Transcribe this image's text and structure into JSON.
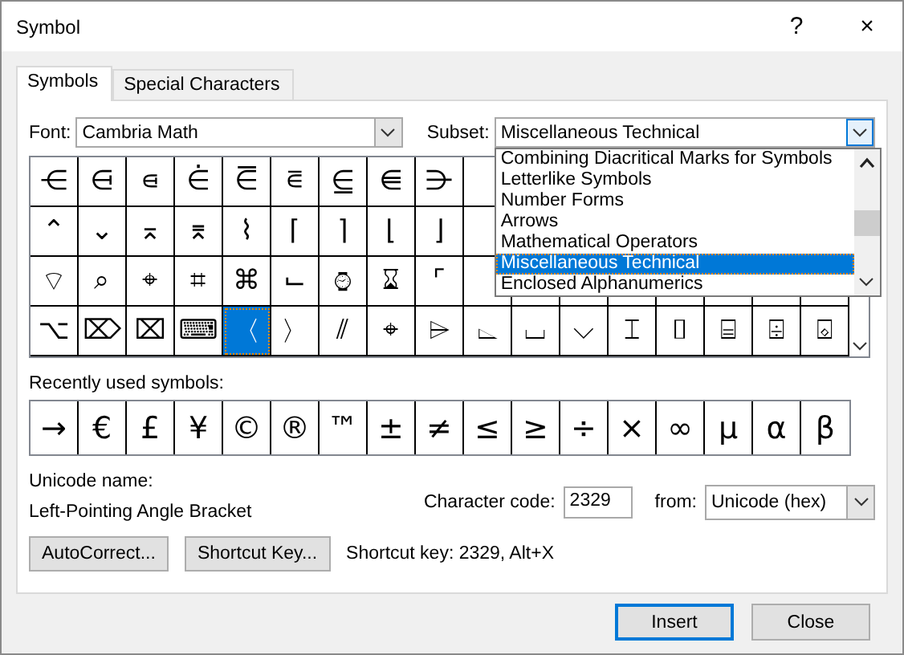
{
  "window": {
    "title": "Symbol",
    "help_button": "?",
    "close_button": "×"
  },
  "tabs": [
    {
      "label": "Symbols",
      "selected": true
    },
    {
      "label": "Special Characters",
      "selected": false
    }
  ],
  "font": {
    "label": "Font:",
    "value": "Cambria Math"
  },
  "subset": {
    "label": "Subset:",
    "value": "Miscellaneous Technical",
    "expanded": true,
    "options": [
      {
        "label": "Combining Diacritical Marks for Symbols",
        "selected": false
      },
      {
        "label": "Letterlike Symbols",
        "selected": false
      },
      {
        "label": "Number Forms",
        "selected": false
      },
      {
        "label": "Arrows",
        "selected": false
      },
      {
        "label": "Mathematical Operators",
        "selected": false
      },
      {
        "label": "Miscellaneous Technical",
        "selected": true
      },
      {
        "label": "Enclosed Alphanumerics",
        "selected": false
      }
    ]
  },
  "symbol_grid": {
    "rows": [
      {
        "cells": [
          {
            "symbol": "⋲",
            "selected": false
          },
          {
            "symbol": "⋳",
            "selected": false
          },
          {
            "symbol": "⋴",
            "selected": false
          },
          {
            "symbol": "⋵",
            "selected": false
          },
          {
            "symbol": "⋶",
            "selected": false
          },
          {
            "symbol": "⋷",
            "selected": false
          },
          {
            "symbol": "⋸",
            "selected": false
          },
          {
            "symbol": "⋹",
            "selected": false
          },
          {
            "symbol": "⋺",
            "selected": false
          }
        ]
      },
      {
        "cells": [
          {
            "symbol": "⌃",
            "selected": false
          },
          {
            "symbol": "⌄",
            "selected": false
          },
          {
            "symbol": "⌅",
            "selected": false
          },
          {
            "symbol": "⌆",
            "selected": false
          },
          {
            "symbol": "⌇",
            "selected": false
          },
          {
            "symbol": "⌈",
            "selected": false
          },
          {
            "symbol": "⌉",
            "selected": false
          },
          {
            "symbol": "⌊",
            "selected": false
          },
          {
            "symbol": "⌋",
            "selected": false
          }
        ]
      },
      {
        "cells": [
          {
            "symbol": "⌔",
            "selected": false
          },
          {
            "symbol": "⌕",
            "selected": false
          },
          {
            "symbol": "⌖",
            "selected": false
          },
          {
            "symbol": "⌗",
            "selected": false
          },
          {
            "symbol": "⌘",
            "selected": false
          },
          {
            "symbol": "⌙",
            "selected": false
          },
          {
            "symbol": "⌚︎",
            "selected": false
          },
          {
            "symbol": "⌛︎",
            "selected": false
          },
          {
            "symbol": "⌜",
            "selected": false
          }
        ]
      },
      {
        "cells": [
          {
            "symbol": "⌥",
            "selected": false
          },
          {
            "symbol": "⌦",
            "selected": false
          },
          {
            "symbol": "⌧",
            "selected": false
          },
          {
            "symbol": "⌨",
            "selected": false
          },
          {
            "symbol": "〈",
            "selected": true
          },
          {
            "symbol": "〉",
            "selected": false
          },
          {
            "symbol": "⫽",
            "selected": false
          },
          {
            "symbol": "⌖",
            "selected": false
          },
          {
            "symbol": "⌲",
            "selected": false
          },
          {
            "symbol": "⌳",
            "selected": false
          },
          {
            "symbol": "⌴",
            "selected": false
          },
          {
            "symbol": "⌵",
            "selected": false
          },
          {
            "symbol": "⌶",
            "selected": false
          },
          {
            "symbol": "⌷",
            "selected": false
          },
          {
            "symbol": "⌸",
            "selected": false
          },
          {
            "symbol": "⌹",
            "selected": false
          },
          {
            "symbol": "⌺",
            "selected": false
          }
        ]
      }
    ]
  },
  "recent": {
    "label": "Recently used symbols:",
    "symbols": [
      "→",
      "€",
      "£",
      "¥",
      "©",
      "®",
      "™",
      "±",
      "≠",
      "≤",
      "≥",
      "÷",
      "×",
      "∞",
      "µ",
      "α",
      "β"
    ]
  },
  "unicode_name": {
    "label": "Unicode name:",
    "value": "Left-Pointing Angle Bracket"
  },
  "character_code": {
    "label": "Character code:",
    "value": "2329"
  },
  "from": {
    "label": "from:",
    "value": "Unicode (hex)"
  },
  "buttons": [
    {
      "label": "AutoCorrect..."
    },
    {
      "label": "Shortcut Key..."
    }
  ],
  "shortcut_text": "Shortcut key: 2329, Alt+X",
  "dialog_buttons": [
    {
      "label": "Insert",
      "default": true
    },
    {
      "label": "Close",
      "default": false
    }
  ]
}
